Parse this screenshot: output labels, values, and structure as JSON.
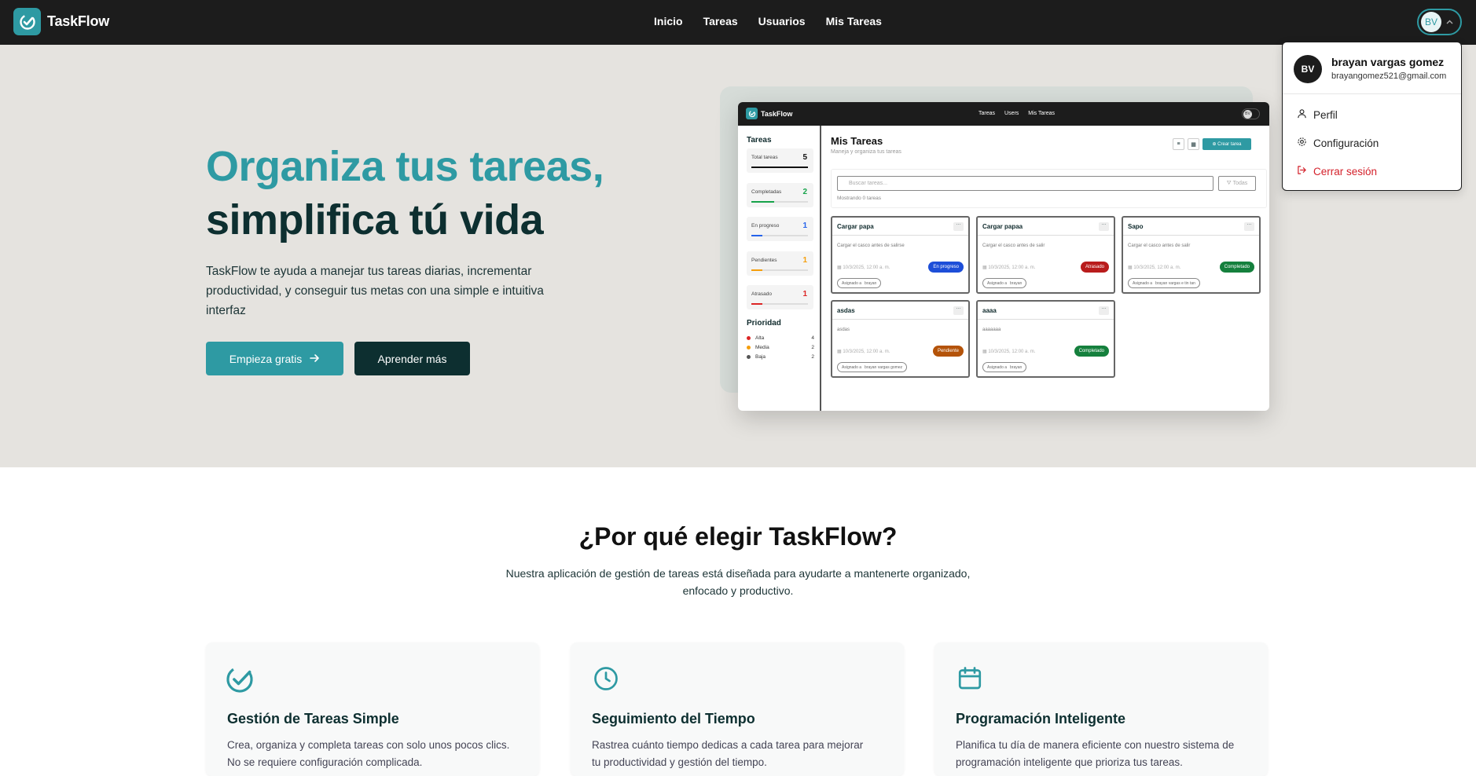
{
  "nav": {
    "brand": "TaskFlow",
    "links": [
      "Inicio",
      "Tareas",
      "Usuarios",
      "Mis Tareas"
    ],
    "avatar_initials": "BV"
  },
  "hero": {
    "title_line1": "Organiza tus tareas,",
    "title_line2": "simplifica tú vida",
    "description": "TaskFlow te ayuda a manejar tus tareas diarias, incrementar productividad, y conseguir tus metas con una simple e intuitiva interfaz",
    "cta_primary": "Empieza gratis",
    "cta_secondary": "Aprender más"
  },
  "preview": {
    "brand": "TaskFlow",
    "links": [
      "Tareas",
      "Users",
      "Mis Tareas"
    ],
    "avatar": "BV",
    "sidebar_title": "Tareas",
    "stats": [
      {
        "label": "Total tareas",
        "value": "5",
        "color": "#111111",
        "fill": 1.0
      },
      {
        "label": "Completadas",
        "value": "2",
        "color": "#16a34a",
        "fill": 0.4
      },
      {
        "label": "En progreso",
        "value": "1",
        "color": "#2563eb",
        "fill": 0.2
      },
      {
        "label": "Pendientes",
        "value": "1",
        "color": "#f59e0b",
        "fill": 0.2
      },
      {
        "label": "Atrasado",
        "value": "1",
        "color": "#dc2626",
        "fill": 0.2
      }
    ],
    "priority_title": "Prioridad",
    "priorities": [
      {
        "label": "Alta",
        "count": "4",
        "color": "#dc2626"
      },
      {
        "label": "Media",
        "count": "2",
        "color": "#f59e0b"
      },
      {
        "label": "Baja",
        "count": "2",
        "color": "#555555"
      }
    ],
    "main_title": "Mis Tareas",
    "main_subtitle": "Maneja y organiza tus tareas",
    "create_button": "Crear tarea",
    "search_placeholder": "Buscar tareas...",
    "filter_label": "Todas",
    "showing": "Mostrando 0 tareas",
    "cards": [
      {
        "title": "Cargar papa",
        "desc": "Cargar el casco antes de salirse",
        "date": "10/3/2025, 12:00 a. m.",
        "status": "En progreso",
        "status_color": "#1d4ed8",
        "assignee": "brayan"
      },
      {
        "title": "Cargar papaa",
        "desc": "Cargar el casco antes de salir",
        "date": "10/3/2025, 12:00 a. m.",
        "status": "Atrasado",
        "status_color": "#b91c1c",
        "assignee": "brayan"
      },
      {
        "title": "Sapo",
        "desc": "Cargar el casco antes de salir",
        "date": "10/3/2025, 12:00 a. m.",
        "status": "Completado",
        "status_color": "#15803d",
        "assignee": "brayan vargas e tin tan"
      },
      {
        "title": "asdas",
        "desc": "asdas",
        "date": "10/3/2025, 12:00 a. m.",
        "status": "Pendiente",
        "status_color": "#b45309",
        "assignee": "brayan vargas gomez"
      },
      {
        "title": "aaaa",
        "desc": "aaaaaaa",
        "date": "10/3/2025, 12:00 a. m.",
        "status": "Completado",
        "status_color": "#15803d",
        "assignee": "brayan"
      }
    ],
    "assigned_prefix": "Asignado a"
  },
  "dropdown": {
    "initials": "BV",
    "name": "brayan vargas gomez",
    "email": "brayangomez521@gmail.com",
    "items": [
      "Perfil",
      "Configuración",
      "Cerrar sesión"
    ]
  },
  "features": {
    "title": "¿Por qué elegir TaskFlow?",
    "subtitle": "Nuestra aplicación de gestión de tareas está diseñada para ayudarte a mantenerte organizado, enfocado y productivo.",
    "cards": [
      {
        "icon": "check-circle-icon",
        "title": "Gestión de Tareas Simple",
        "desc": "Crea, organiza y completa tareas con solo unos pocos clics. No se requiere configuración complicada."
      },
      {
        "icon": "clock-icon",
        "title": "Seguimiento del Tiempo",
        "desc": "Rastrea cuánto tiempo dedicas a cada tarea para mejorar tu productividad y gestión del tiempo."
      },
      {
        "icon": "calendar-icon",
        "title": "Programación Inteligente",
        "desc": "Planifica tu día de manera eficiente con nuestro sistema de programación inteligente que prioriza tus tareas."
      }
    ]
  },
  "colors": {
    "accent": "#2e9aa3",
    "dark": "#0d2f30",
    "nav": "#1c1c1c",
    "danger": "#d4212b"
  }
}
